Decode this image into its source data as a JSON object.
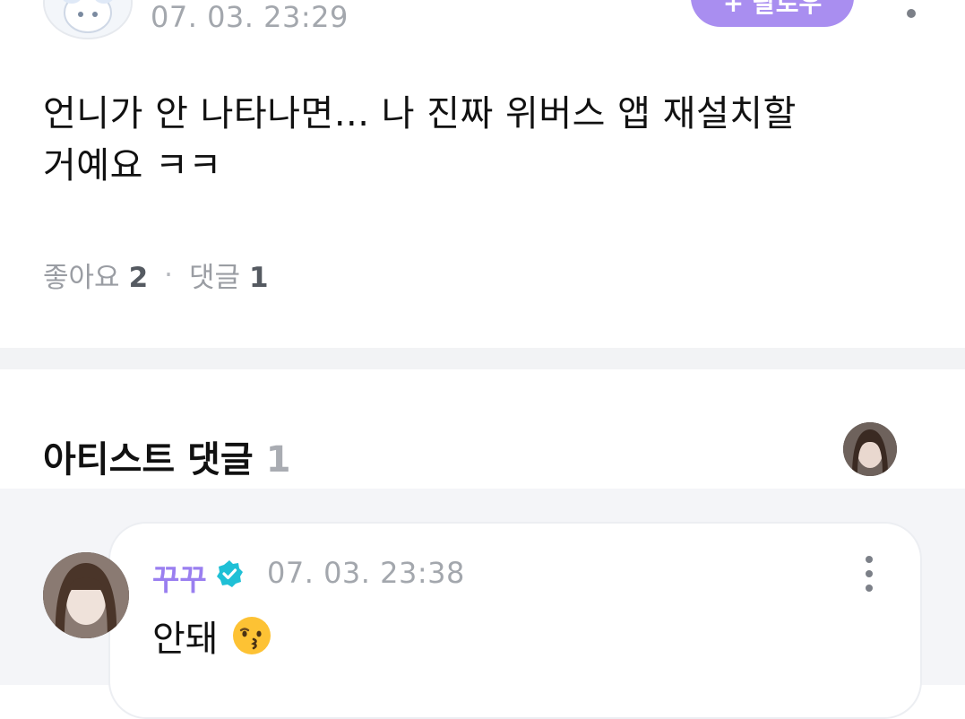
{
  "post": {
    "timestamp": "07. 03. 23:29",
    "follow_label": "+ 팔로우",
    "body_line1": "언니가 안 나타나면... 나 진짜 위버스 앱 재설치할",
    "body_line2": "거예요 ㅋㅋ",
    "likes_label": "좋아요",
    "likes_count": "2",
    "separator": "·",
    "comments_label": "댓글",
    "comments_count": "1"
  },
  "artist_comments": {
    "title": "아티스트 댓글",
    "count": "1"
  },
  "comment": {
    "author": "꾸꾸",
    "verified_icon": "verified-badge-icon",
    "timestamp": "07. 03. 23:38",
    "text": "안돼",
    "emoji": "kissing-face-icon"
  },
  "colors": {
    "accent": "#a98ef0",
    "author": "#9a7ff0",
    "verified": "#1fc0d6",
    "muted": "#a3a7ad",
    "divider": "#f2f3f5"
  }
}
